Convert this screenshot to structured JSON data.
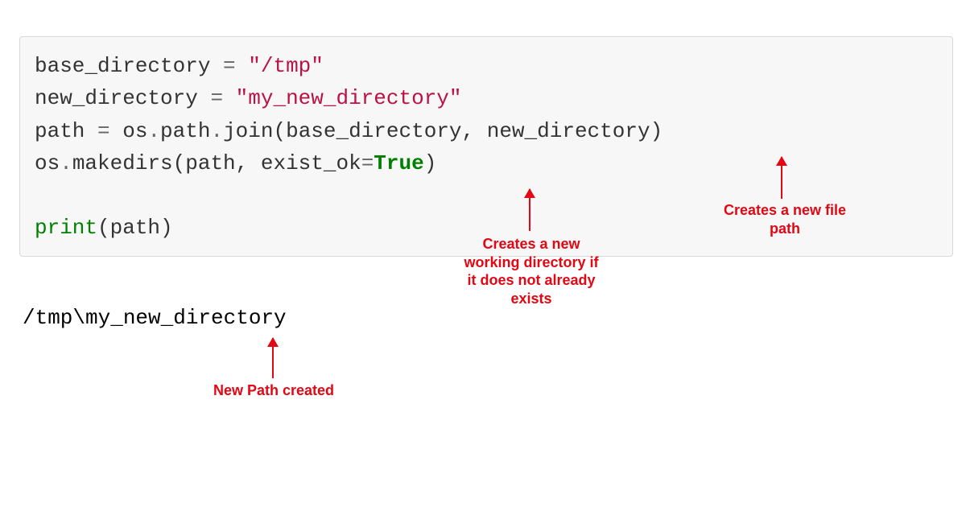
{
  "code": {
    "l1_a": "base_directory ",
    "l1_op": "=",
    "l1_b": " ",
    "l1_str": "\"/tmp\"",
    "l2_a": "new_directory ",
    "l2_op": "=",
    "l2_b": " ",
    "l2_str": "\"my_new_directory\"",
    "l3_a": "path ",
    "l3_op": "=",
    "l3_b": " os",
    "l3_dot1": ".",
    "l3_c": "path",
    "l3_dot2": ".",
    "l3_d": "join(base_directory, new_directory)",
    "l4_a": "os",
    "l4_dot": ".",
    "l4_b": "makedirs(path, exist_ok",
    "l4_eq": "=",
    "l4_true": "True",
    "l4_close": ")",
    "l6_print": "print",
    "l6_rest": "(path)"
  },
  "output": "/tmp\\my_new_directory",
  "annotations": {
    "makedirs": "Creates a new\nworking directory if\nit does not already\nexists",
    "join": "Creates a new file\npath",
    "result": "New Path created"
  },
  "colors": {
    "annotation": "#e30613",
    "code_bg": "#f7f7f7",
    "string": "#bb1144",
    "keyword": "#008000"
  }
}
